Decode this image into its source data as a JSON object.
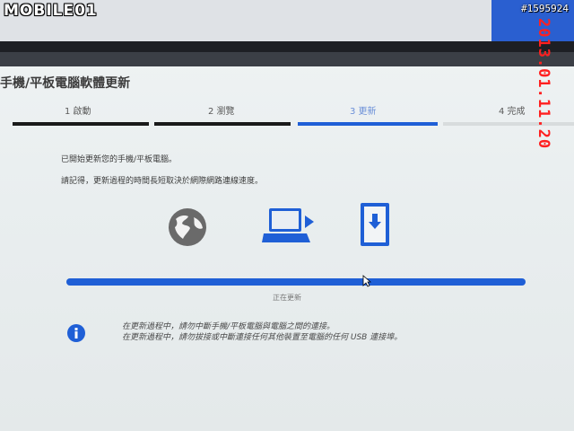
{
  "watermark": {
    "logo": "MOBILE01",
    "post_id": "#1595924",
    "timestamp": "2013.01.11.20"
  },
  "window": {
    "title": "手機/平板電腦軟體更新"
  },
  "steps": [
    {
      "label": "1  啟動",
      "state": "done"
    },
    {
      "label": "2  瀏覽",
      "state": "done"
    },
    {
      "label": "3  更新",
      "state": "active"
    },
    {
      "label": "4  完成",
      "state": "pending"
    }
  ],
  "messages": {
    "started": "已開始更新您的手機/平板電腦。",
    "note": "請記得，更新過程的時間長短取決於網際網路連線速度。"
  },
  "icons": {
    "source": "globe-icon",
    "computer": "laptop-icon",
    "device": "phone-download-icon",
    "info": "info-icon"
  },
  "progress": {
    "fraction": 1.0,
    "status": "正在更新"
  },
  "warnings": {
    "line1": "在更新過程中，請勿中斷手機/平板電腦與電腦之間的連接。",
    "line2": "在更新過程中，請勿拔接或中斷連接任何其他裝置至電腦的任何 USB 連接埠。"
  },
  "colors": {
    "accent": "#1f5fd6",
    "timestamp": "#ff2020"
  }
}
